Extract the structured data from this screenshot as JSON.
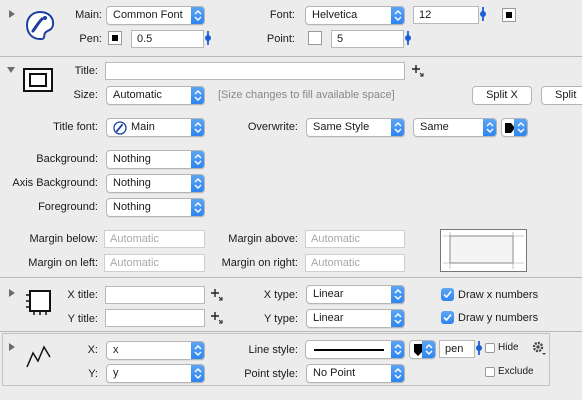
{
  "main_section": {
    "main_label": "Main:",
    "main_value": "Common Font",
    "font_label": "Font:",
    "font_value": "Helvetica",
    "font_size": "12",
    "pen_label": "Pen:",
    "pen_value": "0.5",
    "point_label": "Point:",
    "point_value": "5"
  },
  "graph_section": {
    "title_label": "Title:",
    "title_value": "",
    "size_label": "Size:",
    "size_value": "Automatic",
    "size_hint": "[Size changes to fill available space]",
    "split_x": "Split X",
    "split_y": "Split",
    "title_font_label": "Title font:",
    "title_font_value": "Main",
    "overwrite_label": "Overwrite:",
    "overwrite_value": "Same Style",
    "overwrite_same": "Same",
    "background_label": "Background:",
    "background_value": "Nothing",
    "axis_background_label": "Axis Background:",
    "axis_background_value": "Nothing",
    "foreground_label": "Foreground:",
    "foreground_value": "Nothing",
    "margin_below_label": "Margin below:",
    "margin_below_placeholder": "Automatic",
    "margin_above_label": "Margin above:",
    "margin_above_placeholder": "Automatic",
    "margin_left_label": "Margin on left:",
    "margin_left_placeholder": "Automatic",
    "margin_right_label": "Margin on right:",
    "margin_right_placeholder": "Automatic"
  },
  "axis_section": {
    "x_title_label": "X title:",
    "x_title_value": "",
    "y_title_label": "Y title:",
    "y_title_value": "",
    "x_type_label": "X type:",
    "x_type_value": "Linear",
    "y_type_label": "Y type:",
    "y_type_value": "Linear",
    "draw_x_numbers": "Draw x numbers",
    "draw_y_numbers": "Draw y numbers",
    "draw_x_checked": true,
    "draw_y_checked": true
  },
  "plot_section": {
    "x_label": "X:",
    "x_value": "x",
    "y_label": "Y:",
    "y_value": "y",
    "line_style_label": "Line style:",
    "pen_field": "pen",
    "hide_label": "Hide",
    "point_style_label": "Point style:",
    "point_style_value": "No Point",
    "exclude_label": "Exclude"
  },
  "colors": {
    "panel_bg": "#ececec",
    "accent": "#2c83ef"
  }
}
